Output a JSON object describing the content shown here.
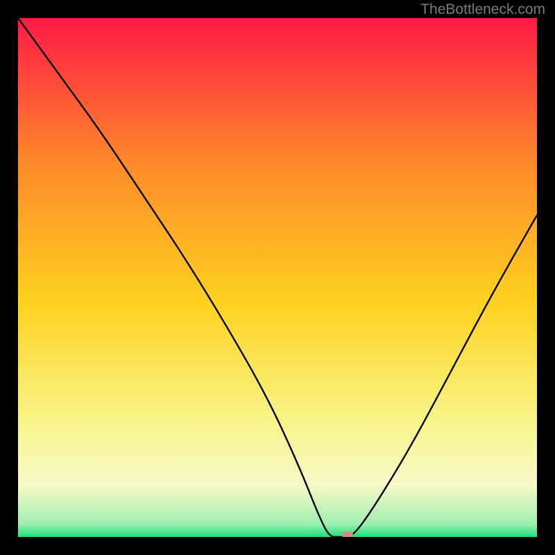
{
  "watermark": "TheBottleneck.com",
  "chart_data": {
    "type": "line",
    "title": "",
    "xlabel": "",
    "ylabel": "",
    "x_range": [
      0,
      100
    ],
    "y_range": [
      0,
      100
    ],
    "series": [
      {
        "name": "bottleneck-curve",
        "x": [
          0,
          8,
          16,
          24,
          32,
          40,
          48,
          54,
          58,
          60,
          62,
          64,
          66,
          70,
          76,
          84,
          92,
          100
        ],
        "y": [
          100,
          89,
          78,
          66,
          54,
          41,
          27,
          14,
          4,
          0,
          0,
          0,
          2,
          8,
          18,
          33,
          48,
          62
        ]
      }
    ],
    "marker": {
      "x": 63.5,
      "y": 0.4,
      "color": "#d58a84",
      "label": "optimal-point"
    },
    "gradient": {
      "top": "#ff1a47",
      "q1": "#ff8a2a",
      "mid": "#ffd21f",
      "q3": "#f8f58a",
      "band": "#f7f9c8",
      "bottom": "#1ee07a"
    }
  }
}
